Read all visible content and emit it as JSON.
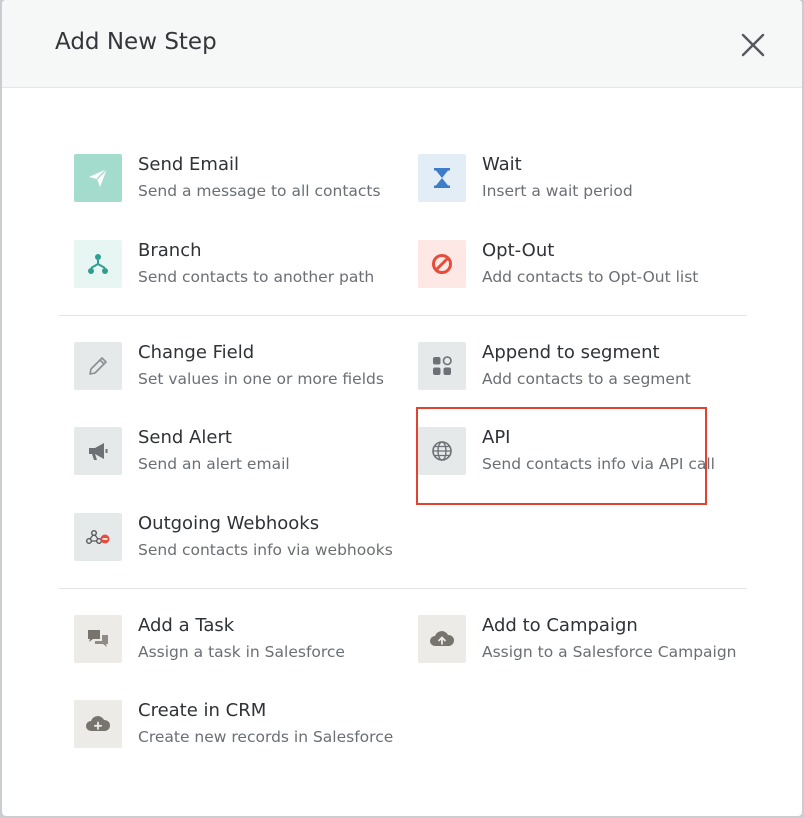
{
  "modal": {
    "title": "Add New Step",
    "close_icon": "close-icon"
  },
  "colors": {
    "highlight": "#e0432f",
    "send_email_bg": "#a3dccd",
    "wait_bg": "#e3edf6",
    "branch_bg": "#e8f6f3",
    "optout_bg": "#fde8e6",
    "neutral_bg": "#e6e9e9",
    "crm_bg": "#ecebe7"
  },
  "steps": {
    "send_email": {
      "title": "Send Email",
      "desc": "Send a message to all contacts",
      "icon": "paper-plane-icon"
    },
    "wait": {
      "title": "Wait",
      "desc": "Insert a wait period",
      "icon": "hourglass-icon"
    },
    "branch": {
      "title": "Branch",
      "desc": "Send contacts to another path",
      "icon": "branch-icon"
    },
    "opt_out": {
      "title": "Opt-Out",
      "desc": "Add contacts to Opt-Out list",
      "icon": "ban-icon"
    },
    "change_field": {
      "title": "Change Field",
      "desc": "Set values in one or more fields",
      "icon": "pencil-icon"
    },
    "append_segment": {
      "title": "Append to segment",
      "desc": "Add contacts to a segment",
      "icon": "segment-icon"
    },
    "send_alert": {
      "title": "Send Alert",
      "desc": "Send an alert email",
      "icon": "megaphone-icon"
    },
    "api": {
      "title": "API",
      "desc": "Send contacts info via API call",
      "icon": "globe-icon"
    },
    "webhooks": {
      "title": "Outgoing Webhooks",
      "desc": "Send contacts info via webhooks",
      "icon": "webhook-icon"
    },
    "add_task": {
      "title": "Add a Task",
      "desc": "Assign a task in Salesforce",
      "icon": "chat-bubbles-icon"
    },
    "add_campaign": {
      "title": "Add to Campaign",
      "desc": "Assign to a Salesforce Campaign",
      "icon": "cloud-upload-icon"
    },
    "create_crm": {
      "title": "Create in CRM",
      "desc": "Create new records in Salesforce",
      "icon": "cloud-plus-icon"
    }
  }
}
